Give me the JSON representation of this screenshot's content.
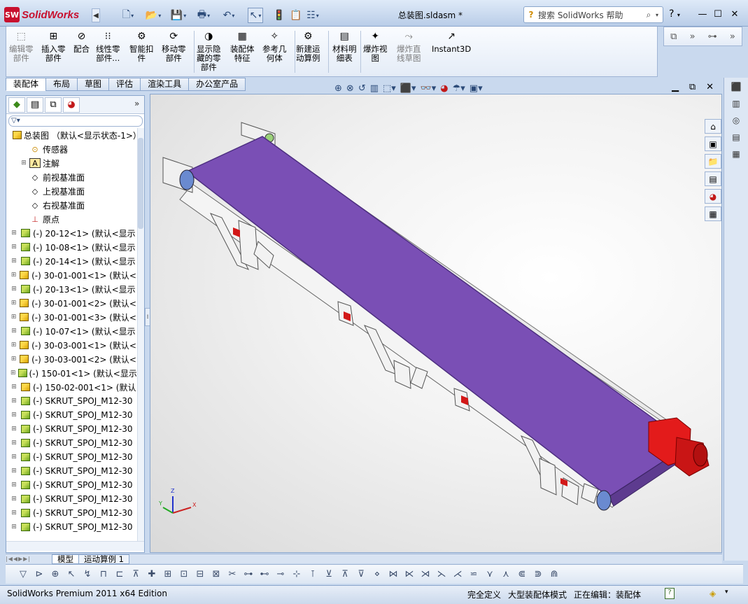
{
  "app": {
    "brand": "SolidWorks",
    "logo_badge": "SW",
    "doc_title": "总装图.sldasm *"
  },
  "search": {
    "placeholder": "搜索 SolidWorks 帮助"
  },
  "help": {
    "label": "?"
  },
  "commands": [
    {
      "label": "编辑零\n部件",
      "icon": "edit-component-icon",
      "disabled": true
    },
    {
      "label": "插入零\n部件",
      "icon": "insert-component-icon"
    },
    {
      "label": "配合",
      "icon": "mate-icon"
    },
    {
      "label": "线性零\n部件...",
      "icon": "linear-pattern-icon"
    },
    {
      "label": "智能扣\n件",
      "icon": "smart-fastener-icon"
    },
    {
      "label": "移动零\n部件",
      "icon": "move-component-icon"
    },
    {
      "label": "显示隐\n藏的零\n部件",
      "icon": "show-hidden-icon"
    },
    {
      "label": "装配体\n特征",
      "icon": "assembly-feature-icon"
    },
    {
      "label": "参考几\n何体",
      "icon": "reference-geometry-icon"
    },
    {
      "label": "新建运\n动算例",
      "icon": "new-motion-study-icon"
    },
    {
      "label": "材料明\n细表",
      "icon": "bom-icon"
    },
    {
      "label": "爆炸视\n图",
      "icon": "exploded-view-icon"
    },
    {
      "label": "爆炸直\n线草图",
      "icon": "explode-line-sketch-icon",
      "disabled": true
    },
    {
      "label": "Instant3D",
      "icon": "instant3d-icon"
    }
  ],
  "tabs": [
    "装配体",
    "布局",
    "草图",
    "评估",
    "渲染工具",
    "办公室产品"
  ],
  "tree": {
    "root": "总装图 （默认<显示状态-1>）",
    "items": [
      {
        "label": "传感器",
        "icon": "sensor",
        "indent": 1,
        "expand": false
      },
      {
        "label": "注解",
        "icon": "annotation",
        "indent": 1,
        "expand": true
      },
      {
        "label": "前视基准面",
        "icon": "plane",
        "indent": 1,
        "expand": false
      },
      {
        "label": "上视基准面",
        "icon": "plane",
        "indent": 1,
        "expand": false
      },
      {
        "label": "右视基准面",
        "icon": "plane",
        "indent": 1,
        "expand": false
      },
      {
        "label": "原点",
        "icon": "origin",
        "indent": 1,
        "expand": false
      },
      {
        "label": "(-) 20-12<1> (默认<显示",
        "icon": "part-green",
        "expand": true
      },
      {
        "label": "(-) 10-08<1> (默认<显示",
        "icon": "part-green",
        "expand": true
      },
      {
        "label": "(-) 20-14<1> (默认<显示",
        "icon": "part-green",
        "expand": true
      },
      {
        "label": "(-) 30-01-001<1> (默认<",
        "icon": "part-yellow",
        "expand": true
      },
      {
        "label": "(-) 20-13<1> (默认<显示",
        "icon": "part-green",
        "expand": true
      },
      {
        "label": "(-) 30-01-001<2> (默认<",
        "icon": "part-yellow",
        "expand": true
      },
      {
        "label": "(-) 30-01-001<3> (默认<",
        "icon": "part-yellow",
        "expand": true
      },
      {
        "label": "(-) 10-07<1> (默认<显示",
        "icon": "part-green",
        "expand": true
      },
      {
        "label": "(-) 30-03-001<1> (默认<",
        "icon": "part-yellow",
        "expand": true
      },
      {
        "label": "(-) 30-03-001<2> (默认<",
        "icon": "part-yellow",
        "expand": true
      },
      {
        "label": "(-) 150-01<1> (默认<显示",
        "icon": "part-green",
        "expand": true
      },
      {
        "label": "(-) 150-02-001<1> (默认",
        "icon": "part-yellow",
        "expand": true
      },
      {
        "label": "(-) SKRUT_SPOJ_M12-30",
        "icon": "part-green",
        "expand": true
      },
      {
        "label": "(-) SKRUT_SPOJ_M12-30",
        "icon": "part-green",
        "expand": true
      },
      {
        "label": "(-) SKRUT_SPOJ_M12-30",
        "icon": "part-green",
        "expand": true
      },
      {
        "label": "(-) SKRUT_SPOJ_M12-30",
        "icon": "part-green",
        "expand": true
      },
      {
        "label": "(-) SKRUT_SPOJ_M12-30",
        "icon": "part-green",
        "expand": true
      },
      {
        "label": "(-) SKRUT_SPOJ_M12-30",
        "icon": "part-green",
        "expand": true
      },
      {
        "label": "(-) SKRUT_SPOJ_M12-30",
        "icon": "part-green",
        "expand": true
      },
      {
        "label": "(-) SKRUT_SPOJ_M12-30",
        "icon": "part-green",
        "expand": true
      },
      {
        "label": "(-) SKRUT_SPOJ_M12-30",
        "icon": "part-green",
        "expand": true
      },
      {
        "label": "(-) SKRUT_SPOJ_M12-30",
        "icon": "part-green",
        "expand": true
      }
    ]
  },
  "model_tabs": [
    "模型",
    "运动算例 1"
  ],
  "triad": {
    "x": "X",
    "y": "Y",
    "z": "Z"
  },
  "status": {
    "edition": "SolidWorks Premium 2011 x64 Edition",
    "defined": "完全定义",
    "mode": "大型装配体模式",
    "editing": "正在编辑：装配体"
  },
  "colors": {
    "belt": "#7d52b8",
    "motor": "#e31b1b",
    "accent": "#c8102e"
  }
}
